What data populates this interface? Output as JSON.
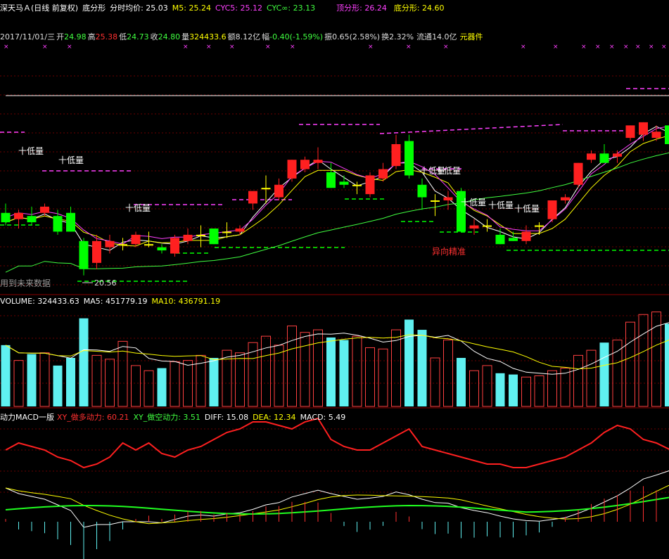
{
  "header": {
    "title": "深天马Ａ(日线 前复权)",
    "indicator_name": "底分形",
    "avg_price_label": "分时均价: 25.03",
    "m5_label": "M5: 25.24",
    "cyc5_label": "CYC5: 25.12",
    "cycinf_label": "CYC∞: 23.13",
    "top_fractal_label": "顶分形: 26.24",
    "bottom_fractal_label": "底分形: 24.60"
  },
  "quote": {
    "date": "2017/11/01/三",
    "open_label": "开",
    "open": "24.98",
    "high_label": "高",
    "high": "25.38",
    "low_label": "低",
    "low": "24.73",
    "close_label": "收",
    "close": "24.80",
    "vol_label": "量",
    "vol": "324433.6",
    "amount_label": "额",
    "amount": "8.12亿",
    "change_label": "幅",
    "change": "-0.40(-1.59%)",
    "amplitude_label": "振",
    "amplitude": "0.65(2.58%)",
    "turnover_label": "换",
    "turnover": "2.32%",
    "float_label": "流通",
    "float": "14.0亿",
    "sector": "元器件"
  },
  "annotations": {
    "labels": [
      "十低量",
      "十低量",
      "十低量",
      "十低量",
      "十低量",
      "十低量",
      "十低量",
      "十低量"
    ],
    "warning": "异向精准",
    "future_data": "用到未来数据",
    "low_price": "20.56"
  },
  "volume_panel": {
    "vol_label": "VOLUME: 324433.63",
    "ma5_label": "MA5: 451779.19",
    "ma10_label": "MA10: 436791.19"
  },
  "macd_panel": {
    "name": "动力MACD一版",
    "xy_long_label": "XY_做多动力: 60.21",
    "xy_short_label": "XY_做空动力: 3.51",
    "diff_label": "DIFF: 15.08",
    "dea_label": "DEA: 12.34",
    "macd_label": "MACD: 5.49"
  },
  "colors": {
    "up": "#ff2020",
    "down": "#00ff00",
    "doji": "#ffff00",
    "vol_up": "#ff4040",
    "vol_down": "#5ff0f0",
    "text_yellow": "#ffff00",
    "text_magenta": "#ff40ff",
    "text_green": "#40ff40",
    "text_red": "#ff3030"
  },
  "chart_data": {
    "type": "candlestick",
    "ohlc": [
      [
        22.6,
        22.9,
        22.2,
        22.3
      ],
      [
        22.4,
        22.7,
        22.1,
        22.6
      ],
      [
        22.5,
        22.8,
        22.2,
        22.3
      ],
      [
        22.6,
        22.9,
        22.5,
        22.8
      ],
      [
        22.5,
        22.7,
        21.9,
        22.0
      ],
      [
        22.6,
        22.8,
        22.0,
        22.0
      ],
      [
        21.7,
        21.8,
        20.6,
        20.8
      ],
      [
        21.0,
        21.9,
        20.8,
        21.7
      ],
      [
        21.5,
        21.9,
        21.3,
        21.7
      ],
      [
        21.6,
        21.8,
        21.4,
        21.6
      ],
      [
        21.6,
        22.0,
        21.5,
        21.9
      ],
      [
        21.6,
        22.0,
        21.5,
        21.6
      ],
      [
        21.5,
        21.6,
        21.3,
        21.4
      ],
      [
        21.3,
        21.9,
        21.2,
        21.8
      ],
      [
        21.7,
        22.1,
        21.6,
        21.9
      ],
      [
        21.9,
        22.2,
        21.5,
        21.9
      ],
      [
        22.1,
        22.1,
        21.6,
        21.6
      ],
      [
        22.0,
        22.3,
        21.8,
        22.0
      ],
      [
        22.0,
        22.2,
        21.9,
        22.1
      ],
      [
        22.9,
        23.2,
        22.7,
        23.3
      ],
      [
        23.4,
        23.8,
        22.9,
        23.4
      ],
      [
        23.1,
        23.7,
        23.0,
        23.5
      ],
      [
        23.7,
        24.3,
        23.6,
        24.3
      ],
      [
        24.0,
        24.4,
        23.9,
        24.3
      ],
      [
        24.2,
        24.7,
        24.0,
        24.3
      ],
      [
        23.9,
        24.2,
        23.4,
        23.4
      ],
      [
        23.6,
        23.8,
        23.4,
        23.5
      ],
      [
        23.5,
        23.6,
        23.2,
        23.5
      ],
      [
        23.2,
        23.9,
        23.1,
        23.8
      ],
      [
        23.7,
        24.2,
        23.6,
        24.0
      ],
      [
        24.1,
        25.1,
        24.0,
        24.8
      ],
      [
        24.9,
        25.1,
        23.7,
        23.8
      ],
      [
        23.5,
        23.7,
        22.7,
        23.1
      ],
      [
        23.0,
        23.2,
        22.5,
        23.0
      ],
      [
        23.0,
        23.3,
        22.7,
        23.1
      ],
      [
        23.3,
        23.4,
        22.0,
        22.0
      ],
      [
        22.1,
        22.4,
        21.9,
        22.2
      ],
      [
        22.2,
        22.4,
        22.0,
        22.2
      ],
      [
        21.9,
        22.1,
        21.6,
        21.6
      ],
      [
        21.8,
        22.0,
        21.7,
        21.7
      ],
      [
        21.7,
        22.2,
        21.6,
        22.0
      ],
      [
        22.2,
        22.3,
        21.9,
        22.2
      ],
      [
        22.4,
        23.0,
        22.3,
        23.0
      ],
      [
        23.0,
        23.2,
        22.9,
        23.1
      ],
      [
        23.5,
        24.2,
        23.4,
        24.2
      ],
      [
        24.3,
        24.6,
        24.2,
        24.5
      ],
      [
        24.5,
        24.8,
        24.2,
        24.2
      ],
      [
        24.4,
        24.6,
        24.2,
        24.5
      ],
      [
        25.0,
        25.4,
        24.9,
        25.4
      ],
      [
        25.1,
        25.5,
        24.9,
        25.5
      ],
      [
        25.0,
        25.4,
        24.9,
        25.2
      ],
      [
        25.4,
        25.6,
        24.7,
        24.8
      ]
    ],
    "volume": [
      240,
      180,
      205,
      210,
      160,
      190,
      345,
      200,
      185,
      255,
      160,
      140,
      150,
      175,
      180,
      200,
      190,
      220,
      210,
      250,
      275,
      240,
      315,
      290,
      300,
      270,
      260,
      275,
      230,
      225,
      300,
      340,
      300,
      190,
      260,
      190,
      140,
      160,
      130,
      125,
      115,
      120,
      140,
      150,
      200,
      220,
      250,
      260,
      330,
      360,
      370,
      324
    ],
    "xy_long": [
      60,
      62,
      61,
      60,
      58,
      57,
      55,
      56,
      58,
      62,
      60,
      62,
      59,
      58,
      60,
      61,
      63,
      65,
      66,
      68,
      68,
      67,
      66,
      68,
      69,
      63,
      61,
      60,
      60,
      62,
      64,
      66,
      61,
      60,
      59,
      58,
      57,
      56,
      56,
      55,
      55,
      56,
      57,
      58,
      60,
      62,
      65,
      67,
      66,
      63,
      62,
      60.21
    ],
    "diff": [
      12,
      11,
      10.5,
      10,
      9,
      8,
      5,
      5.5,
      5.5,
      6,
      6,
      6,
      5.8,
      6.4,
      7,
      7.2,
      7,
      7.4,
      7.6,
      8.2,
      9,
      9.4,
      10.4,
      11,
      11.6,
      11,
      10.5,
      10,
      10.2,
      10.5,
      11.3,
      10.8,
      10,
      9.4,
      9.3,
      8.5,
      8,
      7.6,
      7,
      6.5,
      6.2,
      6.1,
      6.4,
      6.7,
      7.5,
      8.4,
      9.5,
      10.6,
      12,
      13.6,
      14.3,
      15.08
    ]
  }
}
